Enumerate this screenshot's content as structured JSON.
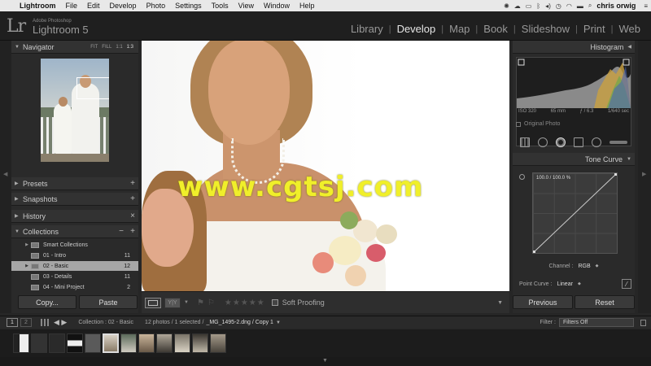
{
  "menubar": {
    "app": "Lightroom",
    "items": [
      "File",
      "Edit",
      "Develop",
      "Photo",
      "Settings",
      "Tools",
      "View",
      "Window",
      "Help"
    ],
    "user": "chris orwig"
  },
  "identity": {
    "logo": "Lr",
    "small": "Adobe Photoshop",
    "name": "Lightroom 5"
  },
  "modules": {
    "items": [
      "Library",
      "Develop",
      "Map",
      "Book",
      "Slideshow",
      "Print",
      "Web"
    ],
    "active": "Develop"
  },
  "left_panel": {
    "navigator": {
      "title": "Navigator",
      "zoom": [
        "FIT",
        "FILL",
        "1:1",
        "1:3"
      ],
      "zoom_selected": "1:3"
    },
    "presets": "Presets",
    "snapshots": "Snapshots",
    "history": "History",
    "collections": {
      "title": "Collections",
      "items": [
        {
          "name": "Smart Collections",
          "count": ""
        },
        {
          "name": "01 - Intro",
          "count": "11"
        },
        {
          "name": "02 - Basic",
          "count": "12"
        },
        {
          "name": "03 - Details",
          "count": "11"
        },
        {
          "name": "04 - Mini Project",
          "count": "2"
        }
      ]
    },
    "copy_label": "Copy...",
    "paste_label": "Paste"
  },
  "image": {
    "watermark": "www.cgtsj.com"
  },
  "toolbar": {
    "soft_proofing": "Soft Proofing",
    "stars": "★★★★★",
    "yy": "Y|Y"
  },
  "right_panel": {
    "histogram": {
      "title": "Histogram",
      "iso": "ISO 320",
      "focal": "65 mm",
      "aperture": "ƒ / 6.3",
      "shutter": "1/640 sec",
      "original": "Original Photo"
    },
    "tone_curve": {
      "title": "Tone Curve",
      "readout": "100.0 / 100.0 %",
      "channel_label": "Channel :",
      "channel_value": "RGB",
      "point_label": "Point Curve :",
      "point_value": "Linear"
    },
    "previous_label": "Previous",
    "reset_label": "Reset"
  },
  "filmbar": {
    "num1": "1",
    "num2": "2",
    "source": "Collection : 02 - Basic",
    "info": "12 photos / 1 selected /",
    "filename": "_MG_1495-2.dng / Copy 1",
    "filter_label": "Filter :",
    "filter_value": "Filters Off"
  },
  "colors": {
    "accent": "#e6e6e6",
    "panel": "#2a2a2a",
    "selected": "#a6a6a6"
  }
}
